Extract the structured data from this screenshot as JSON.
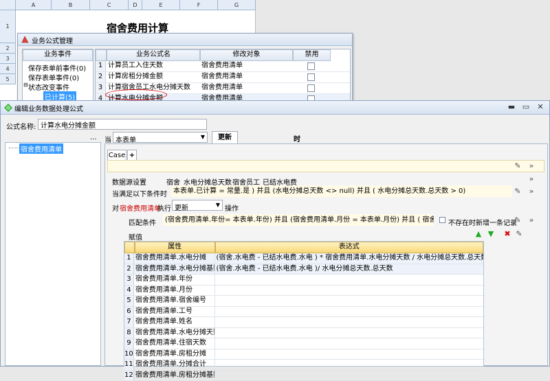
{
  "sheet": {
    "columns": [
      "A",
      "B",
      "C",
      "D",
      "E",
      "F",
      "G"
    ],
    "rows": [
      "1",
      "2",
      "3",
      "4",
      "5"
    ],
    "title": "宿舍费用计算"
  },
  "win1": {
    "title": "业务公式管理",
    "tree_header": "业务事件",
    "tree_items": [
      "保存表单前事件(0)",
      "保存表单事件(0)",
      "状态改变事件",
      "已计算(5)"
    ],
    "grid_headers": [
      "业务公式名",
      "修改对象",
      "禁用"
    ],
    "rows": [
      {
        "num": "1",
        "name": "计算员工入住天数",
        "target": "宿舍费用清单"
      },
      {
        "num": "2",
        "name": "计算房租分摊金额",
        "target": "宿舍费用清单"
      },
      {
        "num": "3",
        "name": "计算宿舍员工水电分摊天数",
        "target": "宿舍费用清单"
      },
      {
        "num": "4",
        "name": "计算水电分摊金额",
        "target": "宿舍费用清单"
      }
    ]
  },
  "win2": {
    "title": "编辑业务数据处理公式",
    "formula_name_label": "公式名称:",
    "formula_name_value": "计算水电分摊金额",
    "ellipsis": "...",
    "tree_item": "宿舍费用清单",
    "when_label": "当",
    "table_select": "本表单",
    "update_label": "更新",
    "time_label": "时",
    "tab_case": "Case",
    "tab_add": "+",
    "datasource_label": "数据源设置",
    "datasource_items": [
      "宿舍",
      "水电分摊总天数",
      "宿舍员工",
      "已结水电费"
    ],
    "condition_label": "当满足以下条件时",
    "condition_value": "本表单.已计算 = 常量.是 ) 并且 (水电分摊总天数 <> null) 并且 ( 水电分摊总天数.总天数 > 0)",
    "target_prefix": "对",
    "target_table": "宿舍费用清单",
    "target_exec": "执行",
    "action_select": "更新",
    "action_suffix": "操作",
    "match_label": "匹配条件",
    "match_value": "(宿舍费用清单.年份= 本表单.年份) 并且 (宿舍费用清单.月份 = 本表单.月份) 并且 ( 宿舍费用清",
    "no_match_label": "不存在时新增一条记录",
    "assign_label": "赋值",
    "grid_headers": [
      "属性",
      "表达式"
    ],
    "rows": [
      {
        "num": "1",
        "attr": "宿舍费用清单.水电分摊",
        "expr": "(宿舍.水电费 - 已结水电费.水电 ) * 宿舍费用清单.水电分摊天数 / 水电分摊总天数.总天数"
      },
      {
        "num": "2",
        "attr": "宿舍费用清单.水电分摊基数",
        "expr": "(宿舍.水电费 - 已结水电费.水电 )/ 水电分摊总天数.总天数"
      },
      {
        "num": "3",
        "attr": "宿舍费用清单.年份",
        "expr": ""
      },
      {
        "num": "4",
        "attr": "宿舍费用清单.月份",
        "expr": ""
      },
      {
        "num": "5",
        "attr": "宿舍费用清单.宿舍编号",
        "expr": ""
      },
      {
        "num": "6",
        "attr": "宿舍费用清单.工号",
        "expr": ""
      },
      {
        "num": "7",
        "attr": "宿舍费用清单.姓名",
        "expr": ""
      },
      {
        "num": "8",
        "attr": "宿舍费用清单.水电分摊天数",
        "expr": ""
      },
      {
        "num": "9",
        "attr": "宿舍费用清单.住宿天数",
        "expr": ""
      },
      {
        "num": "10",
        "attr": "宿舍费用清单.房租分摊",
        "expr": ""
      },
      {
        "num": "11",
        "attr": "宿舍费用清单.分摊合计",
        "expr": ""
      },
      {
        "num": "12",
        "attr": "宿舍费用清单.房租分摊基数",
        "expr": ""
      }
    ]
  },
  "colors": {
    "accent": "#f8d878",
    "selected": "#3399ff",
    "red": "#cc0000"
  }
}
